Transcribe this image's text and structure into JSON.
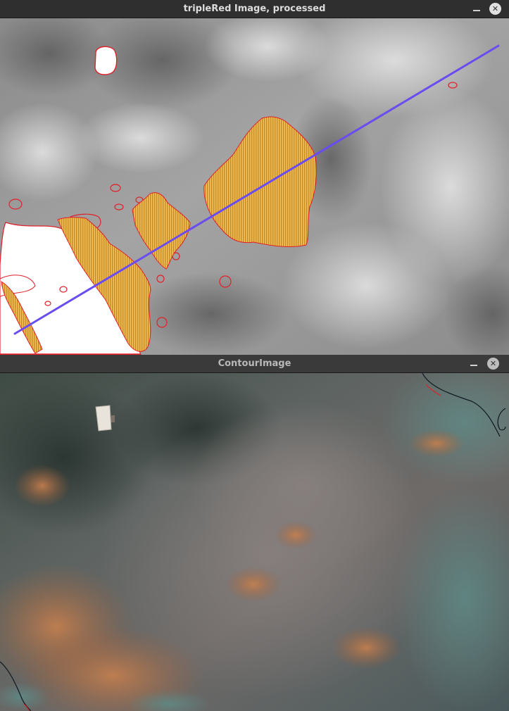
{
  "windows": {
    "processed": {
      "title": "tripleRed Image, processed",
      "minimize_icon": "minimize-icon",
      "close_icon": "close-icon",
      "close_glyph": "✕"
    },
    "contour": {
      "title": "ContourImage",
      "minimize_icon": "minimize-icon",
      "close_icon": "close-icon",
      "close_glyph": "✕"
    }
  },
  "colors": {
    "contour_red": "#e0202a",
    "fill_orange": "#e0a030",
    "fit_line": "#6a4cf0",
    "contour_dark": "#101820"
  }
}
